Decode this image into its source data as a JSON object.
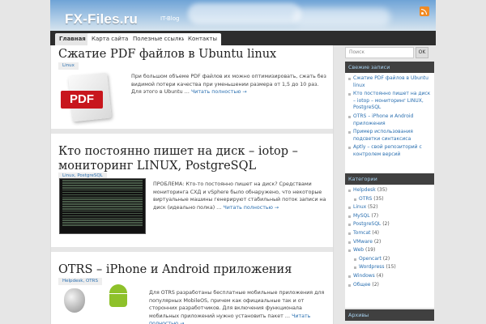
{
  "header": {
    "title": "FX-Files.ru",
    "description": "IT-Blog"
  },
  "nav": {
    "tabs": [
      {
        "label": "Главная",
        "active": true
      },
      {
        "label": "Карта сайта",
        "active": false
      },
      {
        "label": "Полезные ссылки",
        "active": false
      },
      {
        "label": "Контакты",
        "active": false
      }
    ]
  },
  "posts": [
    {
      "title": "Сжатие PDF файлов в Ubuntu linux",
      "tags": "Linux",
      "excerpt": "При большом объеме PDF файлов их можно оптимизировать, сжать без видимой потери качества при уменьшении размера от 1,5 до 10 раз. Для этого в Ubuntu …",
      "more": "Читать полностью →",
      "image_label": "PDF"
    },
    {
      "title": "Кто постоянно пишет на диск – iotop – мониторинг LINUX, PostgreSQL",
      "tags": "Linux, PostgreSQL",
      "excerpt": "ПРОБЛЕМА: Кто-то постоянно пишет на диск? Средствами мониторинга СХД и vSphere было обнаружено, что некоторые виртуальные машины генерируют стабильный поток записи на диск (идеально полка) …",
      "more": "Читать полностью →"
    },
    {
      "title": "OTRS – iPhone и Android приложения",
      "tags": "Helpdesk, OTRS",
      "excerpt": "Для OTRS разработаны бесплатные мобильные приложения для популярных MobileOS, причем как официальные так и от сторонних разработчиков. Для включения функционала мобильных приложений нужно установить пакет …",
      "more": "Читать полностью →"
    }
  ],
  "sidebar": {
    "search_placeholder": "Поиск",
    "search_button": "OK",
    "recent_title": "Свежие записи",
    "recent": [
      "Сжатие PDF файлов в Ubuntu linux",
      "Кто постоянно пишет на диск – iotop – мониторинг LINUX, PostgreSQL",
      "OTRS – iPhone и Android приложения",
      "Пример использования подсветки синтаксиса",
      "Aptly – свой репозиторий с контролем версий"
    ],
    "categories_title": "Категории",
    "categories": [
      {
        "name": "Helpdesk",
        "count": "(35)",
        "sub": false
      },
      {
        "name": "OTRS",
        "count": "(35)",
        "sub": true
      },
      {
        "name": "Linux",
        "count": "(52)",
        "sub": false
      },
      {
        "name": "MySQL",
        "count": "(7)",
        "sub": false
      },
      {
        "name": "PostgreSQL",
        "count": "(2)",
        "sub": false
      },
      {
        "name": "Tomcat",
        "count": "(4)",
        "sub": false
      },
      {
        "name": "VMware",
        "count": "(2)",
        "sub": false
      },
      {
        "name": "Web",
        "count": "(19)",
        "sub": false
      },
      {
        "name": "Opencart",
        "count": "(2)",
        "sub": true
      },
      {
        "name": "Wordpress",
        "count": "(15)",
        "sub": true
      },
      {
        "name": "Windows",
        "count": "(4)",
        "sub": false
      },
      {
        "name": "Общее",
        "count": "(2)",
        "sub": false
      }
    ],
    "archives_title": "Архивы"
  },
  "colors": {
    "accent": "#2a6fb0",
    "widget_header": "#404040",
    "nav_bg": "#2d2d2d"
  },
  "icons": [
    "rss-icon",
    "pdf-icon",
    "apple-icon",
    "android-icon"
  ]
}
